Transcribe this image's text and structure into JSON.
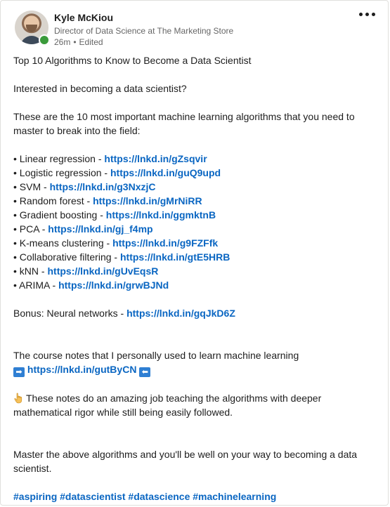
{
  "author": {
    "name": "Kyle McKiou",
    "headline": "Director of Data Science at The Marketing Store",
    "time": "26m",
    "edited": "Edited"
  },
  "post": {
    "title": "Top 10 Algorithms to Know to Become a Data Scientist",
    "question": "Interested in becoming a data scientist?",
    "intro": "These are the 10 most important machine learning algorithms that you need to master to break into the field:",
    "algorithms": [
      {
        "label": "Linear regression",
        "link": "https://lnkd.in/gZsqvir"
      },
      {
        "label": "Logistic regression",
        "link": "https://lnkd.in/guQ9upd"
      },
      {
        "label": "SVM",
        "link": "https://lnkd.in/g3NxzjC"
      },
      {
        "label": "Random forest",
        "link": "https://lnkd.in/gMrNiRR"
      },
      {
        "label": "Gradient boosting",
        "link": "https://lnkd.in/ggmktnB"
      },
      {
        "label": "PCA",
        "link": "https://lnkd.in/gj_f4mp"
      },
      {
        "label": "K-means clustering",
        "link": "https://lnkd.in/g9FZFfk"
      },
      {
        "label": "Collaborative filtering",
        "link": "https://lnkd.in/gtE5HRB"
      },
      {
        "label": "kNN",
        "link": "https://lnkd.in/gUvEqsR"
      },
      {
        "label": "ARIMA",
        "link": "https://lnkd.in/grwBJNd"
      }
    ],
    "bonus": {
      "label": "Bonus: Neural networks",
      "link": "https://lnkd.in/gqJkD6Z"
    },
    "course_notes": "The course notes that I personally used to learn machine learning",
    "course_link": "https://lnkd.in/gutByCN",
    "notes_praise": "These notes do an amazing job teaching the algorithms with deeper mathematical rigor while still being easily followed.",
    "closing": "Master the above algorithms and you'll be well on your way to becoming a data scientist.",
    "hashtags": [
      "#aspiring",
      "#datascientist",
      "#datascience",
      "#machinelearning"
    ]
  },
  "icons": {
    "more": "more-options-icon",
    "globe": "globe-icon",
    "arrow_right": "arrow-right-emoji-icon",
    "arrow_left": "arrow-left-emoji-icon",
    "hand": "pointing-hand-emoji-icon"
  },
  "colors": {
    "link": "#0a66c2",
    "online": "#3b9b3b",
    "meta_text": "#666666"
  }
}
